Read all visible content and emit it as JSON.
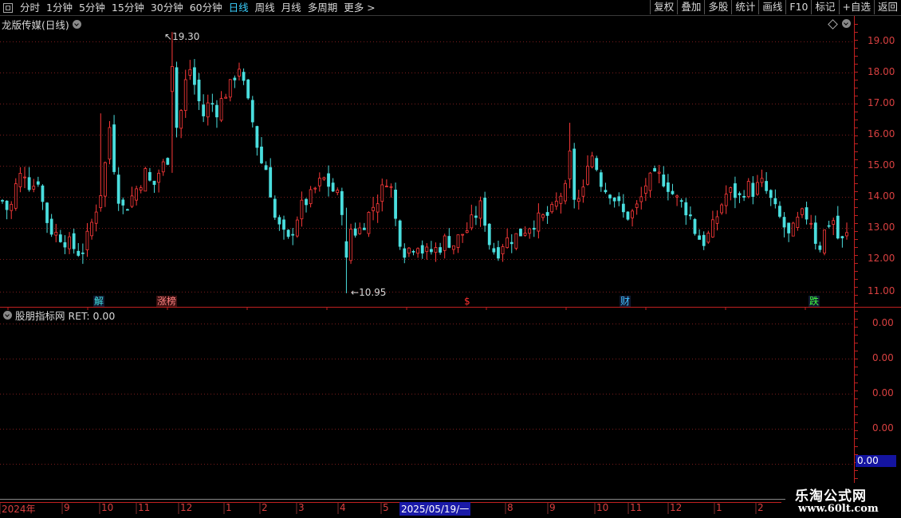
{
  "toolbar": {
    "periods": [
      {
        "label": "分时",
        "active": false
      },
      {
        "label": "1分钟",
        "active": false
      },
      {
        "label": "5分钟",
        "active": false
      },
      {
        "label": "15分钟",
        "active": false
      },
      {
        "label": "30分钟",
        "active": false
      },
      {
        "label": "60分钟",
        "active": false
      },
      {
        "label": "日线",
        "active": true
      },
      {
        "label": "周线",
        "active": false
      },
      {
        "label": "月线",
        "active": false
      },
      {
        "label": "多周期",
        "active": false
      },
      {
        "label": "更多 >",
        "active": false
      }
    ],
    "buttons": [
      "复权",
      "叠加",
      "多股",
      "统计",
      "画线",
      "F10",
      "标记",
      "+自选",
      "返回"
    ]
  },
  "chart": {
    "title": "龙版传媒(日线)",
    "high_label": "19.30",
    "low_label": "10.95",
    "price_ticks": [
      "19.00",
      "18.00",
      "17.00",
      "16.00",
      "15.00",
      "14.00",
      "13.00",
      "12.00",
      "11.00"
    ],
    "markers": [
      {
        "label": "解",
        "color": "#40e0e0"
      },
      {
        "label": "涨榜",
        "color": "#ff8080"
      },
      {
        "label": "$",
        "color": "#ff3030"
      },
      {
        "label": "财",
        "color": "#40c0ff"
      },
      {
        "label": "跌",
        "color": "#40ff40"
      }
    ]
  },
  "indicator": {
    "title": "股朋指标网 RET: 0.00",
    "ticks": [
      "0.00",
      "0.00",
      "0.00",
      "0.00"
    ],
    "current_value": "0.00"
  },
  "timeline": {
    "ticks": [
      "2024年",
      "9",
      "10",
      "11",
      "12",
      "1",
      "2",
      "3",
      "4",
      "5",
      "7",
      "8",
      "9",
      "10",
      "11",
      "12",
      "1",
      "2"
    ],
    "selected": "2025/05/19/一"
  },
  "watermark": {
    "line1": "乐淘公式网",
    "line2": "www.60lt.com"
  },
  "colors": {
    "up": "#ff3a3a",
    "down": "#4adede",
    "grid": "#7a1c1c",
    "axis": "#c02020"
  },
  "chart_data": {
    "type": "candlestick",
    "title": "龙版传媒(日线)",
    "y_axis": {
      "min": 11.0,
      "max": 19.0,
      "ticks": [
        19,
        18,
        17,
        16,
        15,
        14,
        13,
        12,
        11
      ]
    },
    "period_high": 19.3,
    "period_low": 10.95,
    "close_path": [
      13.9,
      13.5,
      14.5,
      14.9,
      14.3,
      14.6,
      13.4,
      12.9,
      12.8,
      12.6,
      12.4,
      12.2,
      12.8,
      13.6,
      14.4,
      16.3,
      14.2,
      13.6,
      14.0,
      14.4,
      14.8,
      14.3,
      14.9,
      15.2,
      16.0,
      16.8,
      18.3,
      17.5,
      16.6,
      17.1,
      16.8,
      17.3,
      17.6,
      18.3,
      17.3,
      16.4,
      15.2,
      14.9,
      13.4,
      12.9,
      12.6,
      13.3,
      13.8,
      14.0,
      14.4,
      14.6,
      14.3,
      14.0,
      13.3,
      12.9,
      13.0,
      13.4,
      13.8,
      14.2,
      14.8,
      13.2,
      12.3,
      12.4,
      12.6,
      12.2,
      12.3,
      12.4,
      12.7,
      12.5,
      12.8,
      13.0,
      13.4,
      13.8,
      12.6,
      12.2,
      12.6,
      12.7,
      12.8,
      13.0,
      13.2,
      13.3,
      13.4,
      13.6,
      14.1,
      14.3,
      14.0,
      13.9,
      15.6,
      15.0,
      14.3,
      14.2,
      13.8,
      13.4,
      13.5,
      13.8,
      14.5,
      14.6,
      14.7,
      14.4,
      14.0,
      13.8,
      13.5,
      12.8,
      12.6,
      12.9,
      13.5,
      14.1,
      14.2,
      14.0,
      14.4,
      14.2,
      14.5,
      14.1,
      13.6,
      13.2,
      12.7,
      13.2,
      13.5,
      13.3,
      12.3,
      13.0,
      13.4,
      12.5,
      12.8
    ]
  }
}
